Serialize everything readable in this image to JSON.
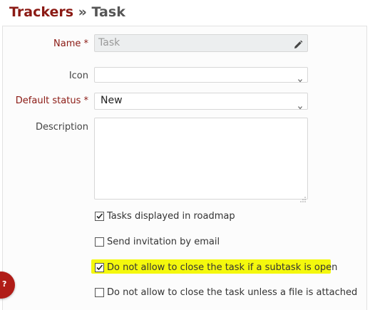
{
  "breadcrumb": {
    "parent": "Trackers",
    "separator": " » ",
    "current": "Task"
  },
  "form": {
    "name": {
      "label": "Name",
      "required_mark": "*",
      "value": "Task"
    },
    "icon": {
      "label": "Icon",
      "value": ""
    },
    "default_status": {
      "label": "Default status",
      "required_mark": "*",
      "value": "New"
    },
    "description": {
      "label": "Description",
      "value": ""
    }
  },
  "checkboxes": [
    {
      "label": "Tasks displayed in roadmap",
      "checked": true
    },
    {
      "label": "Send invitation by email",
      "checked": false
    },
    {
      "label": "Do not allow to close the task if a subtask is open",
      "checked": true,
      "highlighted": true
    },
    {
      "label": "Do not allow to close the task unless a file is attached",
      "checked": false
    }
  ],
  "help_button": {
    "label": "?"
  },
  "colors": {
    "required_label": "#8b1a14",
    "highlight": "#f4f80d",
    "help_button": "#b01c17"
  },
  "icons": [
    "pencil-icon",
    "chevron-down-icon",
    "resize-handle-icon",
    "checkmark-icon",
    "help-icon"
  ]
}
